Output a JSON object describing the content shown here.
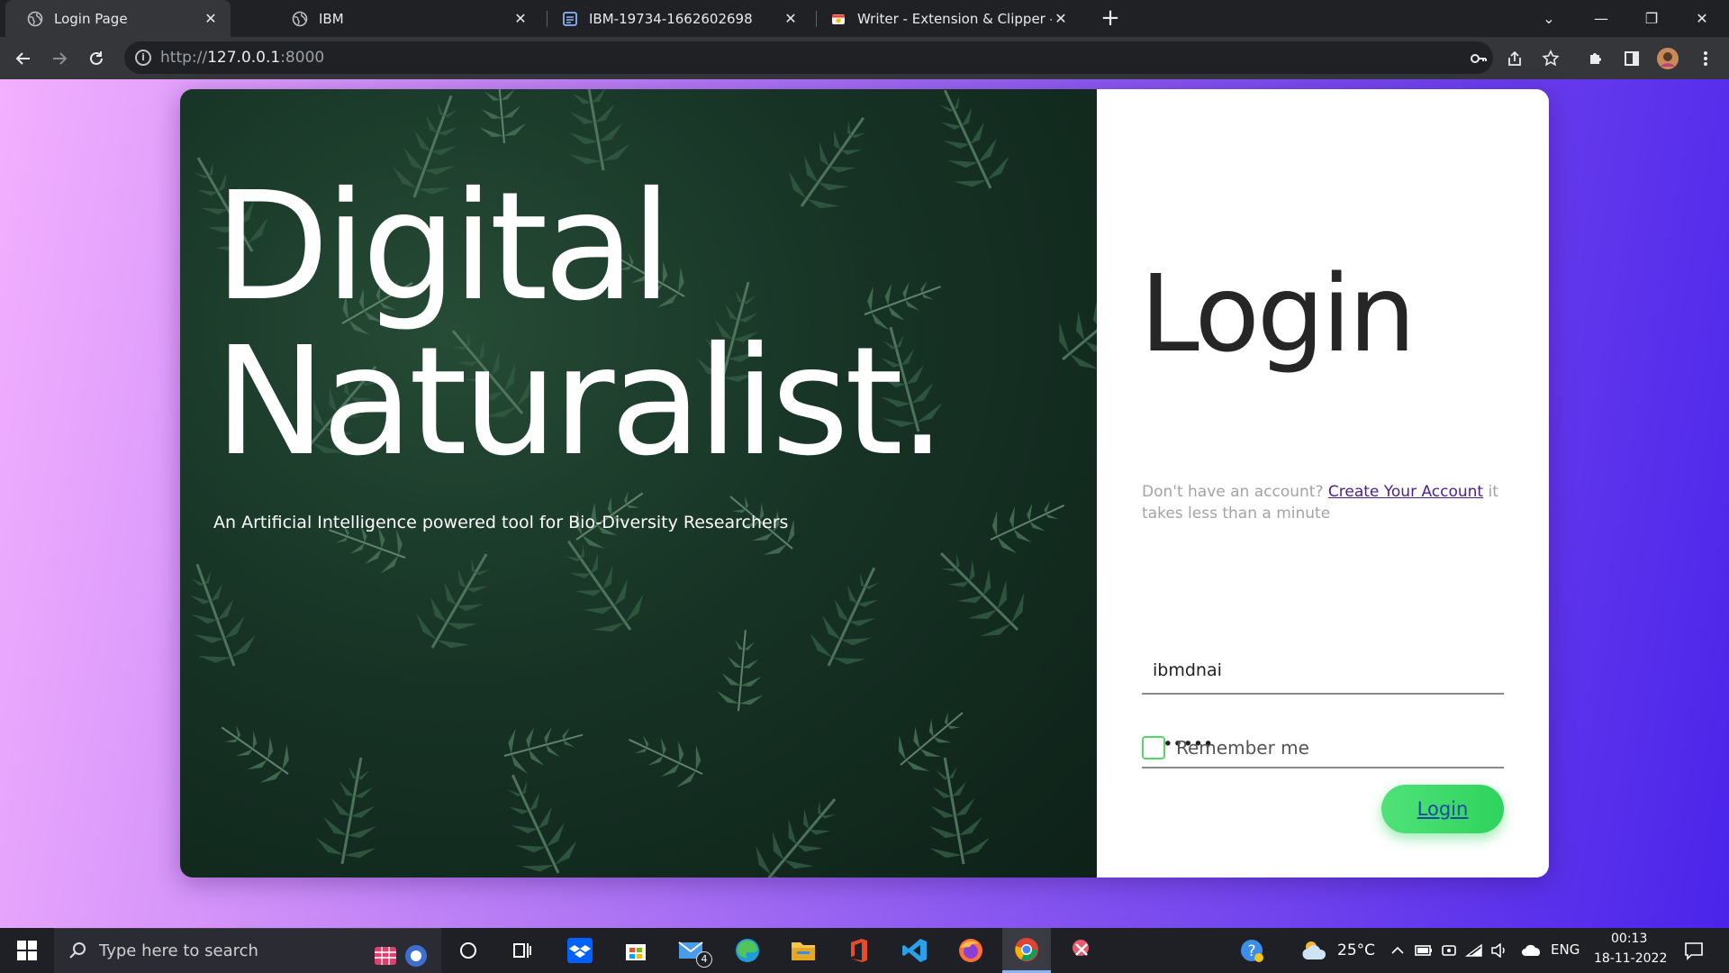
{
  "browser": {
    "tabs": [
      {
        "title": "Login Page",
        "icon": "globe-icon",
        "active": true
      },
      {
        "title": "IBM",
        "icon": "globe-icon",
        "active": false
      },
      {
        "title": "IBM-19734-1662602698",
        "icon": "document-icon",
        "active": false
      },
      {
        "title": "Writer - Extension & Clipper - Ch",
        "icon": "writer-icon",
        "active": false
      }
    ],
    "url_prefix": "http://",
    "url_host": "127.0.0.1",
    "url_port": ":8000"
  },
  "hero": {
    "title_line1": "Digital",
    "title_line2": "Naturalist",
    "title_dot": ".",
    "subtitle": "An Artificial Intelligence powered tool for Bio-Diversity Researchers"
  },
  "login": {
    "heading": "Login",
    "signup_prefix": "Don't have an account? ",
    "signup_link": "Create Your Account",
    "signup_suffix": " it takes less than a minute",
    "username_value": "ibmdnai",
    "password_value": "••••••",
    "remember_label": "Remember me",
    "remember_checked": false,
    "submit_label": "Login"
  },
  "taskbar": {
    "search_placeholder": "Type here to search",
    "mail_badge": "4",
    "weather": "25°C",
    "language": "ENG",
    "time": "00:13",
    "date": "18-11-2022"
  },
  "colors": {
    "accent_green": "#2ed35c",
    "link_purple": "#4b1f8c",
    "page_gradient_start": "#f3b0ff",
    "page_gradient_end": "#4a24ea"
  }
}
